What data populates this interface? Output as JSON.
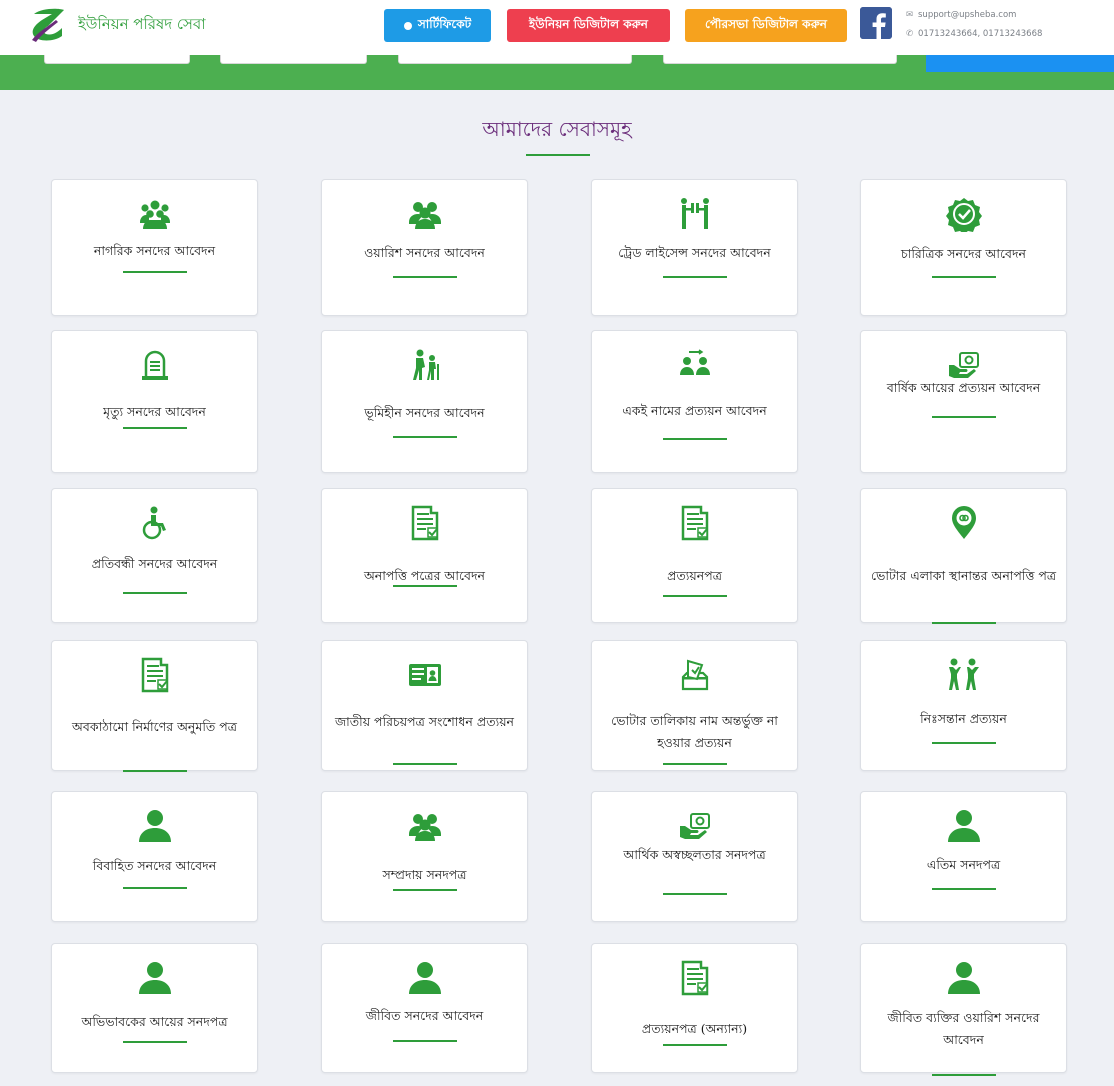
{
  "header": {
    "site_title": "ইউনিয়ন পরিষদ সেবা",
    "btn_certificate": "সার্টিফিকেট",
    "btn_union": "ইউনিয়ন ডিজিটাল করুন",
    "btn_paurashava": "পৌরসভা ডিজিটাল করুন",
    "email": "support@upsheba.com",
    "phone": "01713243664, 01713243668"
  },
  "section": {
    "title": "আমাদের সেবাসমূহ"
  },
  "colors": {
    "brand_green": "#2e9d3a",
    "strip_green": "#4caf50",
    "title_purple": "#6a2c7a",
    "btn_blue": "#1e9be6",
    "btn_red": "#ee3f4f",
    "btn_orange": "#f6a21e"
  },
  "services": [
    {
      "label": "নাগরিক সনদের আবেদন",
      "icon": "people-group-icon"
    },
    {
      "label": "ওয়ারিশ সনদের আবেদন",
      "icon": "users-icon"
    },
    {
      "label": "ট্রেড লাইসেন্স সনদের আবেদন",
      "icon": "trade-people-icon"
    },
    {
      "label": "চারিত্রিক সনদের আবেদন",
      "icon": "badge-check-icon"
    },
    {
      "label": "মৃত্যু সনদের আবেদন",
      "icon": "tombstone-icon"
    },
    {
      "label": "ভূমিহীন সনদের আবেদন",
      "icon": "elderly-couple-icon"
    },
    {
      "label": "একই নামের প্রত্যয়ন আবেদন",
      "icon": "same-name-icon"
    },
    {
      "label": "বার্ষিক আয়ের প্রত্যয়ন আবেদন",
      "icon": "money-hand-icon"
    },
    {
      "label": "প্রতিবন্ধী সনদের আবেদন",
      "icon": "wheelchair-icon"
    },
    {
      "label": "অনাপত্তি পত্রের আবেদন",
      "icon": "document-check-icon"
    },
    {
      "label": "প্রত্যয়নপত্র",
      "icon": "document-check-icon"
    },
    {
      "label": "ভোটার এলাকা স্থানান্তর অনাপত্তি পত্র",
      "icon": "location-pin-icon"
    },
    {
      "label": "অবকাঠামো নির্মাণের অনুমতি পত্র",
      "icon": "document-check-icon"
    },
    {
      "label": "জাতীয় পরিচয়পত্র সংশোধন প্রত্যয়ন",
      "icon": "id-card-icon"
    },
    {
      "label": "ভোটার তালিকায় নাম অন্তর্ভুক্ত না হওয়ার প্রত্যয়ন",
      "icon": "ballot-icon"
    },
    {
      "label": "নিঃসন্তান প্রত্যয়ন",
      "icon": "family-icon"
    },
    {
      "label": "বিবাহিত সনদের আবেদন",
      "icon": "user-icon"
    },
    {
      "label": "সম্প্রদায় সনদপত্র",
      "icon": "users-icon"
    },
    {
      "label": "আর্থিক অস্বচ্ছলতার সনদপত্র",
      "icon": "money-hand-icon"
    },
    {
      "label": "এতিম সনদপত্র",
      "icon": "user-icon"
    },
    {
      "label": "অভিভাবকের আয়ের সনদপত্র",
      "icon": "user-icon"
    },
    {
      "label": "জীবিত সনদের আবেদন",
      "icon": "user-icon"
    },
    {
      "label": "প্রত্যয়নপত্র (অন্যান্য)",
      "icon": "document-check-icon"
    },
    {
      "label": "জীবিত ব্যক্তির ওয়ারিশ সনদের আবেদন",
      "icon": "user-icon"
    }
  ]
}
